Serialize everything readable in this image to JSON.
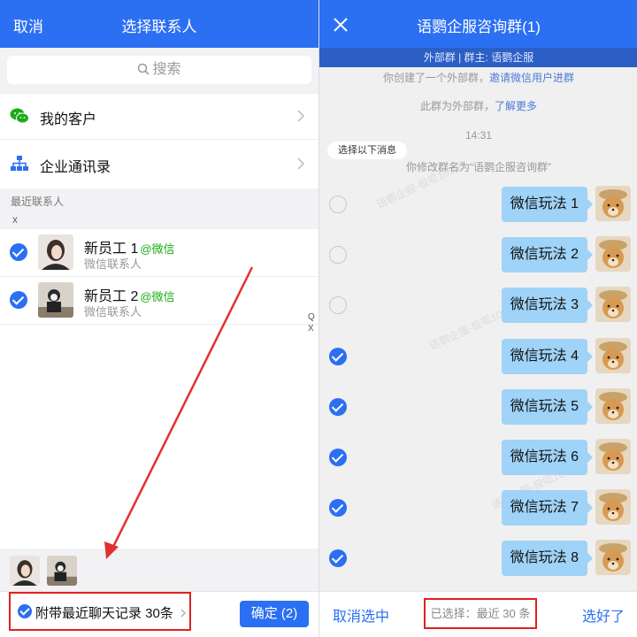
{
  "left": {
    "header": {
      "cancel": "取消",
      "title": "选择联系人"
    },
    "search": {
      "placeholder": "搜索"
    },
    "rows": [
      {
        "label": "我的客户",
        "icon": "wechat-icon"
      },
      {
        "label": "企业通讯录",
        "icon": "org-chart-icon"
      }
    ],
    "recent_label": "最近联系人",
    "x_label": "x",
    "contacts": [
      {
        "name": "新员工 1",
        "tag": "@微信",
        "sub": "微信联系人",
        "checked": true
      },
      {
        "name": "新员工 2",
        "tag": "@微信",
        "sub": "微信联系人",
        "checked": true
      }
    ],
    "side_index": [
      "Q",
      "X"
    ],
    "attach_label": "附带最近聊天记录  30条",
    "confirm_label": "确定 (2)"
  },
  "right": {
    "header": {
      "title": "语鹦企服咨询群(1)"
    },
    "subheader": "外部群 | 群主: 语鹦企服",
    "sys1_text": "你创建了一个外部群，",
    "sys1_link": "邀请微信用户进群",
    "sys2_text": "此群为外部群，",
    "sys2_link": "了解更多",
    "time": "14:31",
    "select_pill": "选择以下消息",
    "rename": "你修改群名为“语鹦企服咨询群”",
    "watermark": "语鹦企服-极呱10305",
    "messages": [
      {
        "text": "微信玩法 1",
        "checked": false
      },
      {
        "text": "微信玩法 2",
        "checked": false
      },
      {
        "text": "微信玩法 3",
        "checked": false
      },
      {
        "text": "微信玩法 4",
        "checked": true
      },
      {
        "text": "微信玩法 5",
        "checked": true
      },
      {
        "text": "微信玩法 6",
        "checked": true
      },
      {
        "text": "微信玩法 7",
        "checked": true
      },
      {
        "text": "微信玩法 8",
        "checked": true
      }
    ],
    "bottom": {
      "cancel": "取消选中",
      "selected": "已选择：最近 30 条",
      "done": "选好了"
    }
  },
  "colors": {
    "brand_blue": "#2b6ff2",
    "bubble": "#9fd3f7",
    "highlight_red": "#e02020",
    "wechat_green": "#1aad19"
  }
}
